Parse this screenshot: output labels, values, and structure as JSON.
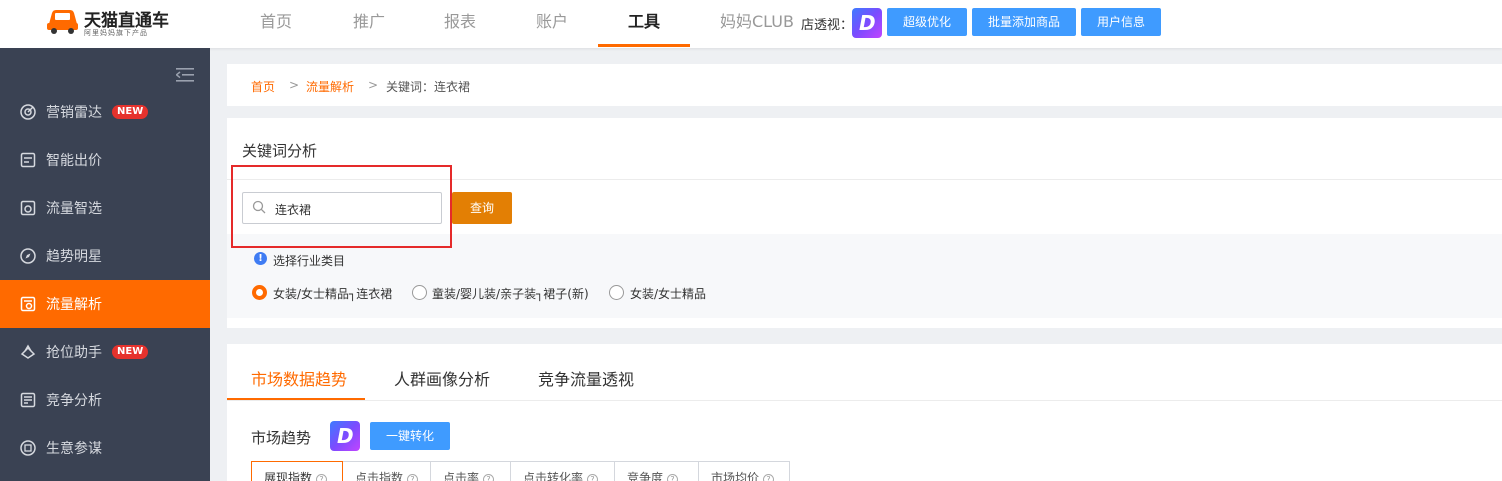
{
  "logo": {
    "title": "天猫直通车",
    "subtitle": "阿里妈妈旗下产品"
  },
  "nav": {
    "items": [
      {
        "label": "首页"
      },
      {
        "label": "推广"
      },
      {
        "label": "报表"
      },
      {
        "label": "账户"
      },
      {
        "label": "工具",
        "active": true
      },
      {
        "label": "妈妈CLUB"
      }
    ],
    "store_label": "店透视：",
    "buttons": [
      "超级优化",
      "批量添加商品",
      "用户信息"
    ]
  },
  "sidebar": {
    "items": [
      {
        "label": "营销雷达",
        "badge": "NEW"
      },
      {
        "label": "智能出价"
      },
      {
        "label": "流量智选"
      },
      {
        "label": "趋势明星"
      },
      {
        "label": "流量解析",
        "active": true
      },
      {
        "label": "抢位助手",
        "badge": "NEW"
      },
      {
        "label": "竞争分析"
      },
      {
        "label": "生意参谋"
      }
    ]
  },
  "breadcrumb": {
    "home": "首页",
    "sep": ">",
    "parent": "流量解析",
    "current": "关键词：连衣裙"
  },
  "keyword": {
    "title": "关键词分析",
    "search_value": "连衣裙",
    "query_label": "查询",
    "category_label": "选择行业类目",
    "options": [
      {
        "label": "女装/女士精品┐连衣裙",
        "selected": true
      },
      {
        "label": "童装/婴儿装/亲子装┐裙子(新)"
      },
      {
        "label": "女装/女士精品"
      }
    ]
  },
  "market": {
    "tabs": [
      "市场数据趋势",
      "人群画像分析",
      "竞争流量透视"
    ],
    "trend_title": "市场趋势",
    "convert_label": "一键转化",
    "metrics": [
      "展现指数",
      "点击指数",
      "点击率",
      "点击转化率",
      "竞争度",
      "市场均价"
    ]
  },
  "colors": {
    "accent": "#ff6a00",
    "sidebar_bg": "#3a4253",
    "blue": "#3f9bff",
    "highlight": "#e52a2a"
  }
}
